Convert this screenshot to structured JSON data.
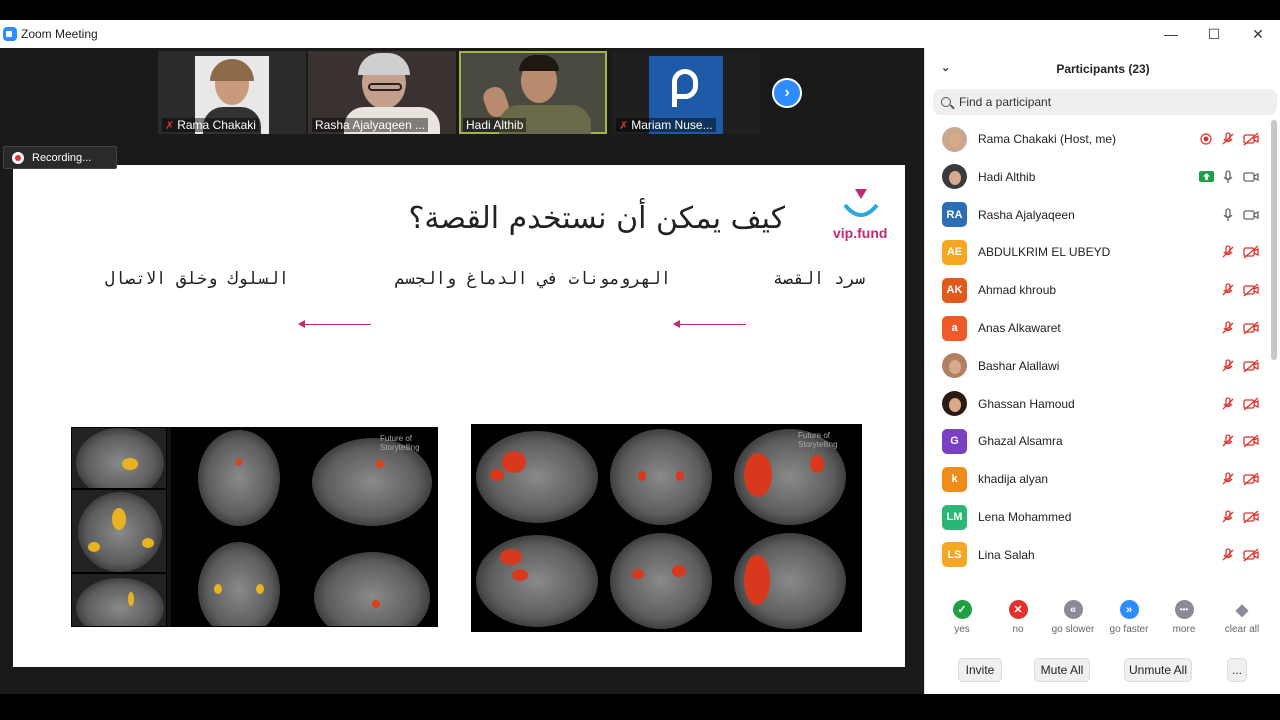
{
  "window": {
    "title": "Zoom Meeting",
    "minimize": "—",
    "maximize": "☐",
    "close": "✕"
  },
  "thumbnails": [
    {
      "name": "Rama Chakaki",
      "muted": true
    },
    {
      "name": "Rasha Ajalyaqeen ...",
      "muted": false
    },
    {
      "name": "Hadi Althib",
      "muted": false
    },
    {
      "name": "Mariam Nuse...",
      "muted": true
    }
  ],
  "recording": {
    "label": "Recording..."
  },
  "slide": {
    "title": "كيف يمكن أن نستخدم القصة؟",
    "logo": "vip.fund",
    "captions": [
      "سرد القصة",
      "الهرومونات في الدماغ والجسم",
      "السلوك وخلق الاتصال"
    ],
    "watermark_left": "Future of Storytelling",
    "watermark_right": "Future of Storytelling"
  },
  "panel": {
    "title": "Participants (23)",
    "search_placeholder": "Find a participant",
    "participants": [
      {
        "name": "Rama Chakaki (Host, me)",
        "initials": "",
        "color": "#caa78f",
        "photo": true,
        "mic": "muted",
        "video": "off",
        "extra": "record"
      },
      {
        "name": "Hadi Althib",
        "initials": "",
        "color": "#3a3a3a",
        "photo": true,
        "mic": "on",
        "video": "on",
        "extra": "share"
      },
      {
        "name": "Rasha Ajalyaqeen",
        "initials": "RA",
        "color": "#2d6db5",
        "photo": false,
        "mic": "on",
        "video": "on",
        "extra": ""
      },
      {
        "name": "ABDULKRIM EL UBEYD",
        "initials": "AE",
        "color": "#f5a623",
        "photo": false,
        "mic": "muted",
        "video": "off",
        "extra": ""
      },
      {
        "name": "Ahmad khroub",
        "initials": "AK",
        "color": "#e05a1a",
        "photo": false,
        "mic": "muted",
        "video": "off",
        "extra": ""
      },
      {
        "name": "Anas Alkawaret",
        "initials": "a",
        "color": "#f05a28",
        "photo": false,
        "mic": "muted",
        "video": "off",
        "extra": ""
      },
      {
        "name": "Bashar Alallawi",
        "initials": "",
        "color": "#b08060",
        "photo": true,
        "mic": "muted",
        "video": "off",
        "extra": ""
      },
      {
        "name": "Ghassan Hamoud",
        "initials": "",
        "color": "#2a1a14",
        "photo": true,
        "mic": "muted",
        "video": "off",
        "extra": ""
      },
      {
        "name": "Ghazal Alsamra",
        "initials": "G",
        "color": "#7a3fc2",
        "photo": false,
        "mic": "muted",
        "video": "off",
        "extra": ""
      },
      {
        "name": "khadija alyan",
        "initials": "k",
        "color": "#f08c1a",
        "photo": false,
        "mic": "muted",
        "video": "off",
        "extra": ""
      },
      {
        "name": "Lena Mohammed",
        "initials": "LM",
        "color": "#2bb673",
        "photo": false,
        "mic": "muted",
        "video": "off",
        "extra": ""
      },
      {
        "name": "Lina Salah",
        "initials": "LS",
        "color": "#f5a623",
        "photo": false,
        "mic": "muted",
        "video": "off",
        "extra": ""
      }
    ],
    "reactions": [
      {
        "label": "yes",
        "symbol": "✓",
        "color": "#1fa045"
      },
      {
        "label": "no",
        "symbol": "✕",
        "color": "#e0312b"
      },
      {
        "label": "go slower",
        "symbol": "«",
        "color": "#8a8a99"
      },
      {
        "label": "go faster",
        "symbol": "»",
        "color": "#2d8cff"
      },
      {
        "label": "more",
        "symbol": "•••",
        "color": "#8a8a99"
      },
      {
        "label": "clear all",
        "symbol": "◆",
        "color": "#8a8a99"
      }
    ],
    "buttons": {
      "invite": "Invite",
      "mute_all": "Mute All",
      "unmute_all": "Unmute All",
      "more": "..."
    }
  }
}
